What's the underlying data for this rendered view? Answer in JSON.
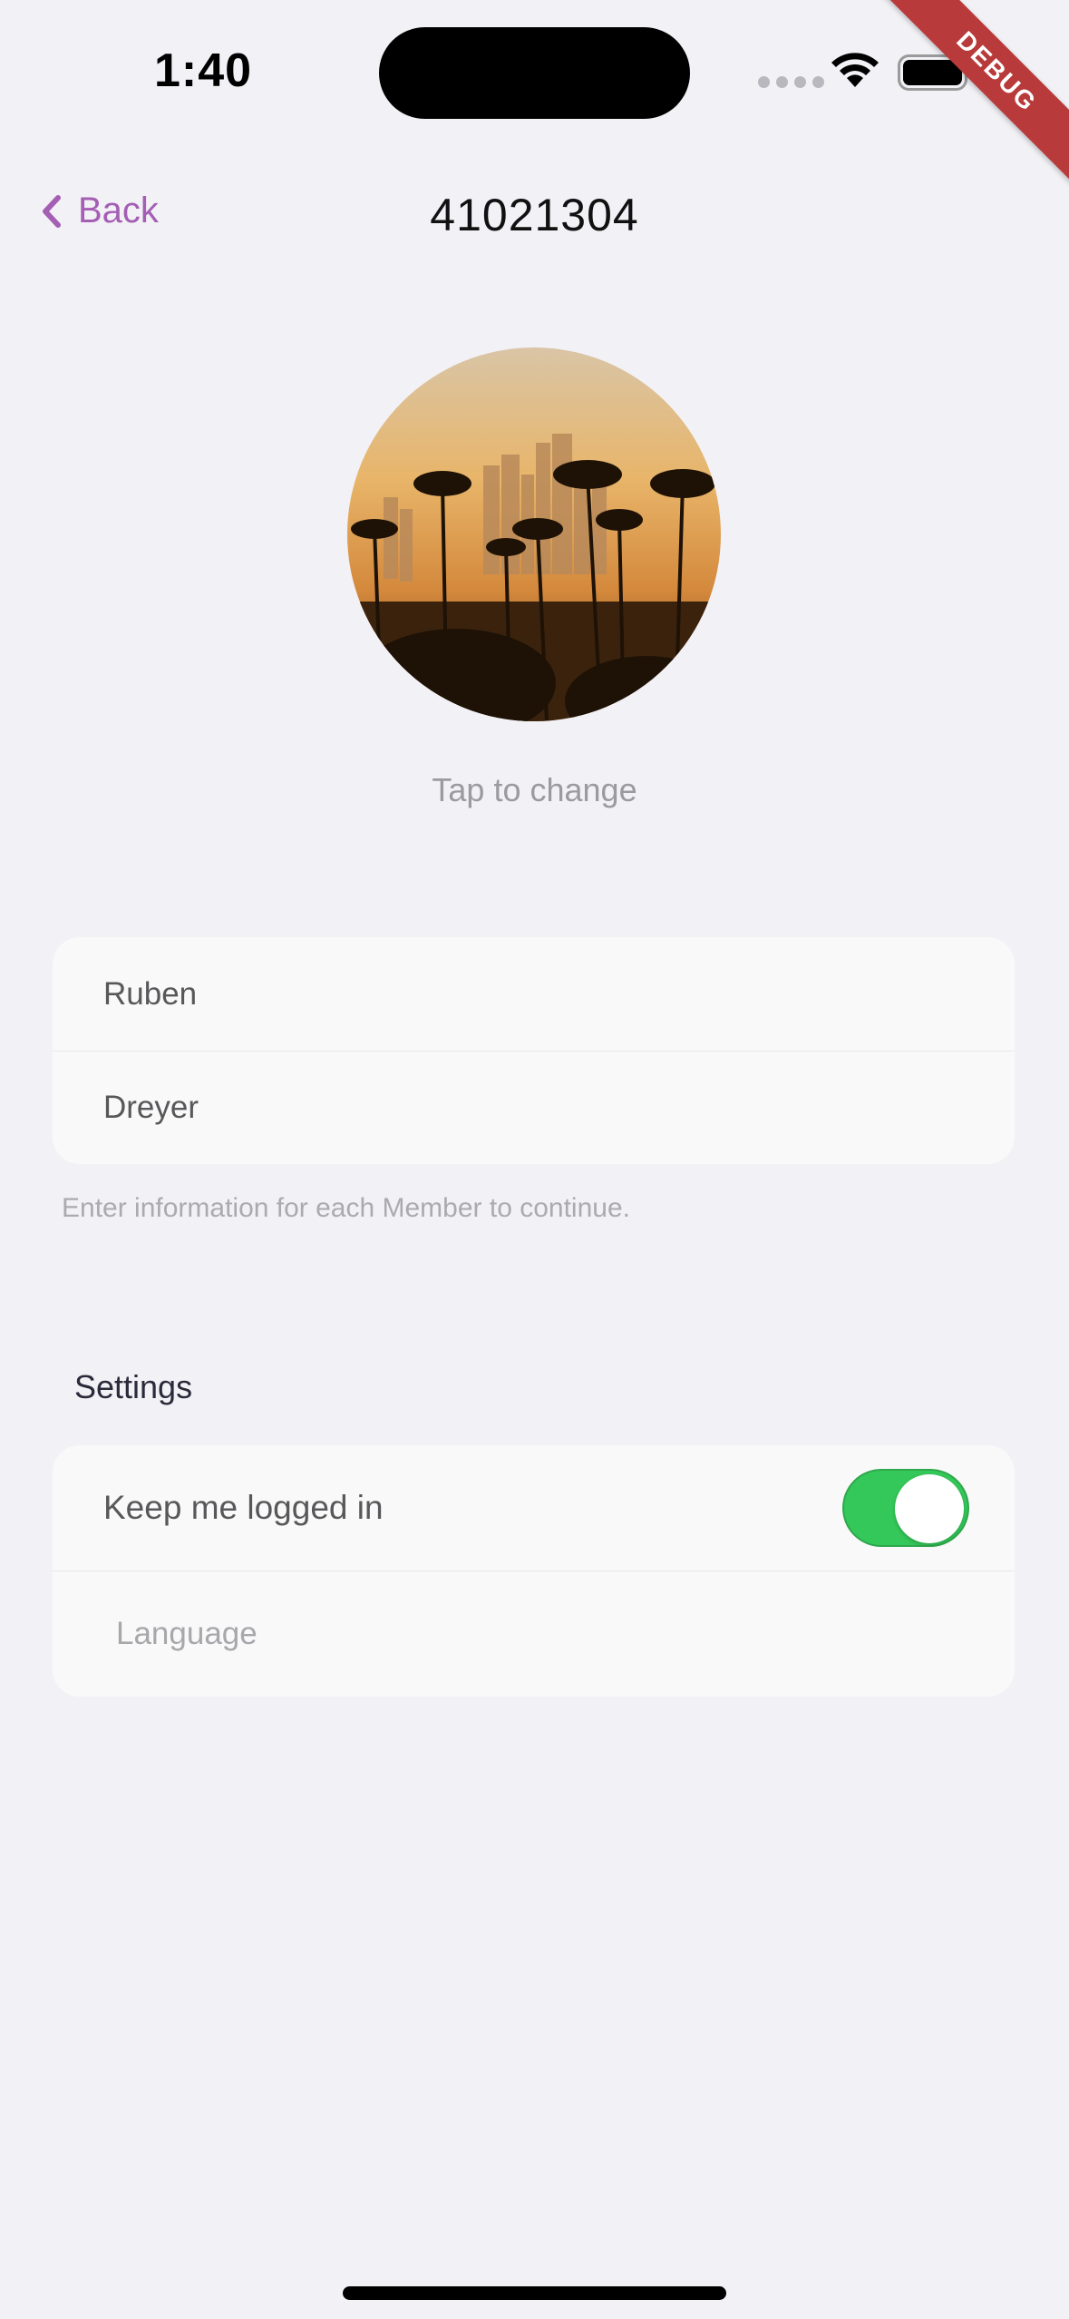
{
  "status_bar": {
    "time": "1:40",
    "icons": [
      "signal-dots-icon",
      "wifi-icon",
      "battery-icon"
    ]
  },
  "debug_banner": {
    "label": "DEBUG",
    "color": "#b83a3a"
  },
  "nav": {
    "back_label": "Back",
    "title": "41021304",
    "accent_color": "#a45fb4"
  },
  "avatar": {
    "change_label": "Tap to change"
  },
  "member": {
    "first_name": "Ruben",
    "last_name": "Dreyer",
    "helper_text": "Enter information for each Member to continue."
  },
  "settings": {
    "header": "Settings",
    "keep_logged_in_label": "Keep me logged in",
    "keep_logged_in_enabled": true,
    "toggle_color": "#34c759",
    "language_placeholder": "Language"
  }
}
